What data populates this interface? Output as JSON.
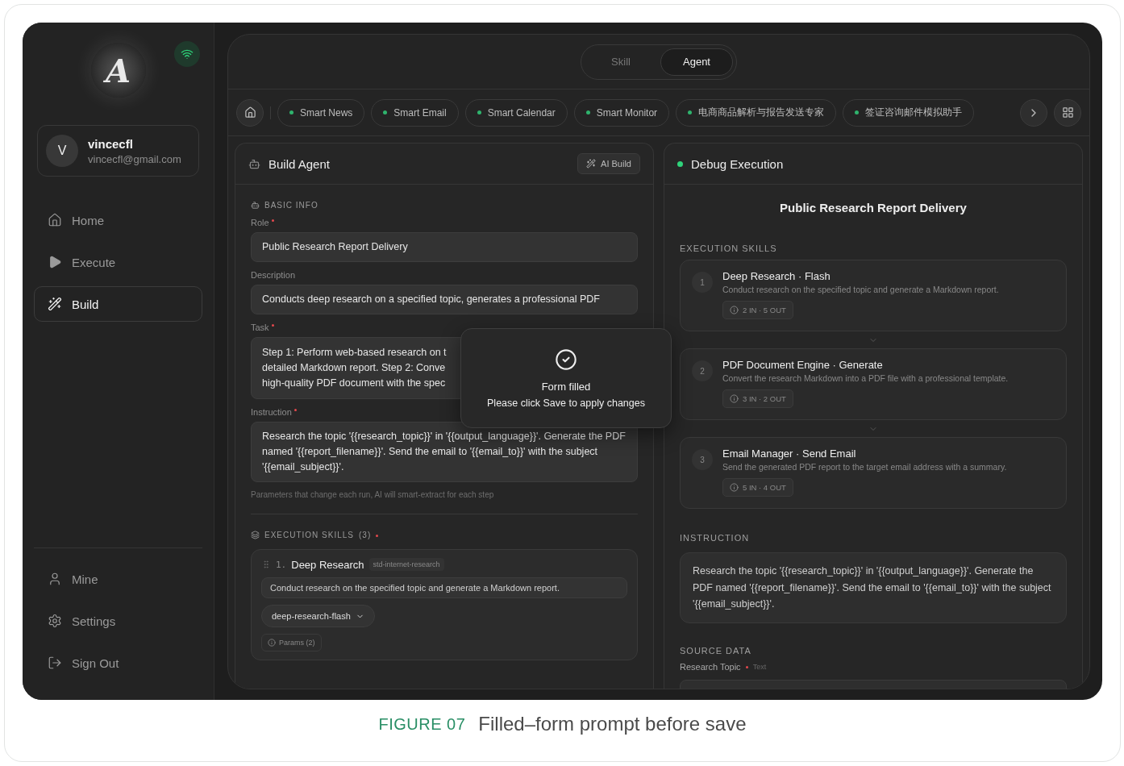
{
  "logo": {
    "letter": "A"
  },
  "sidebar": {
    "user": {
      "initial": "V",
      "name": "vincecfl",
      "email": "vincecfl@gmail.com"
    },
    "nav": [
      {
        "label": "Home",
        "selected": false
      },
      {
        "label": "Execute",
        "selected": false
      },
      {
        "label": "Build",
        "selected": true
      }
    ],
    "bottom_nav": [
      {
        "label": "Mine"
      },
      {
        "label": "Settings"
      },
      {
        "label": "Sign Out"
      }
    ]
  },
  "mode_tabs": [
    {
      "label": "Skill",
      "selected": false
    },
    {
      "label": "Agent",
      "selected": true
    }
  ],
  "quick_agents": [
    {
      "label": "Smart News"
    },
    {
      "label": "Smart Email"
    },
    {
      "label": "Smart Calendar"
    },
    {
      "label": "Smart Monitor"
    },
    {
      "label": "电商商品解析与报告发送专家"
    },
    {
      "label": "签证咨询邮件模拟助手"
    }
  ],
  "build_panel": {
    "title": "Build Agent",
    "ai_button": "AI Build",
    "section": "BASIC INFO",
    "fields": [
      {
        "label": "Role",
        "required": true,
        "lines": [
          "Public Research Report Delivery"
        ]
      },
      {
        "label": "Description",
        "required": false,
        "lines": [
          "Conducts deep research on a specified topic, generates a professional PDF"
        ]
      },
      {
        "label": "Task",
        "required": true,
        "lines": [
          "Step 1: Perform web-based research on t",
          "detailed Markdown report. Step 2: Conve",
          "high-quality PDF document with the spec"
        ]
      },
      {
        "label": "Instruction",
        "required": true,
        "lines": [
          "Research the topic '{{research_topic}}' in '{{output_language}}'. Generate the PDF named '{{report_filename}}'. Send the email to '{{email_to}}' with the subject '{{email_subject}}'."
        ]
      }
    ],
    "hint": "Parameters that change each run, AI will smart-extract for each step",
    "skills_heading": "EXECUTION SKILLS",
    "skills_count": "(3)",
    "skills_required": true,
    "skill": {
      "number": "1.",
      "name": "Deep Research",
      "slug": "std-internet-research",
      "description": "Conduct research on the specified topic and generate a Markdown report.",
      "version": "deep-research-flash",
      "params": "Params (2)"
    }
  },
  "toast": {
    "title": "Form filled",
    "message": "Please click Save to apply changes"
  },
  "debug_panel": {
    "title": "Debug Execution",
    "heading": "Public Research Report Delivery",
    "skills_label": "EXECUTION SKILLS",
    "skills": [
      {
        "number": "1",
        "name": "Deep Research · Flash",
        "description": "Conduct research on the specified topic and generate a Markdown report.",
        "io": "2 IN · 5 OUT"
      },
      {
        "number": "2",
        "name": "PDF Document Engine · Generate",
        "description": "Convert the research Markdown into a PDF file with a professional template.",
        "io": "3 IN · 2 OUT"
      },
      {
        "number": "3",
        "name": "Email Manager · Send Email",
        "description": "Send the generated PDF report to the target email address with a summary.",
        "io": "5 IN · 4 OUT"
      }
    ],
    "instruction_label": "INSTRUCTION",
    "instruction": "Research the topic '{{research_topic}}' in '{{output_language}}'. Generate the PDF named '{{report_filename}}'. Send the email to '{{email_to}}' with the subject '{{email_subject}}'.",
    "source_label": "SOURCE DATA",
    "source_fields": [
      {
        "label": "Research Topic",
        "required": true,
        "type": "Text"
      }
    ]
  },
  "caption": {
    "figure": "FIGURE 07",
    "title": "Filled–form prompt before save"
  }
}
